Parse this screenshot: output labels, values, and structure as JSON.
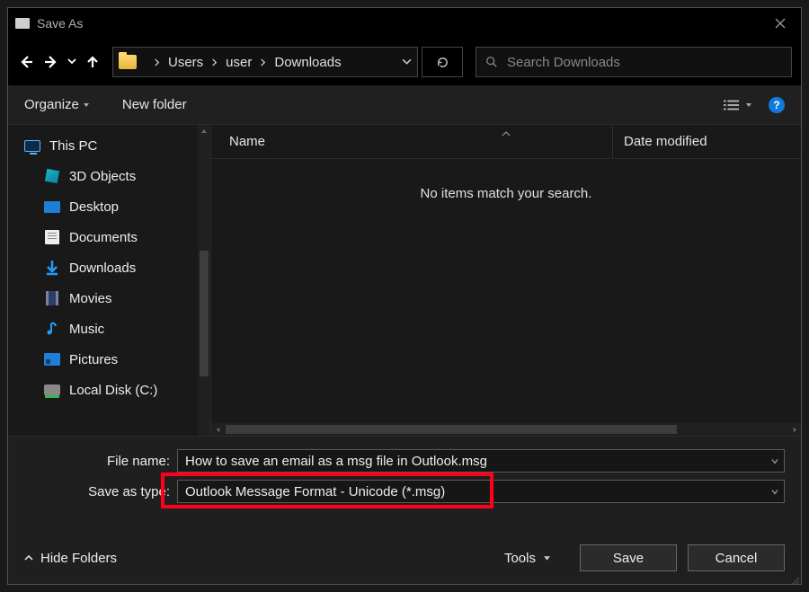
{
  "titlebar": {
    "title": "Save As"
  },
  "nav": {
    "breadcrumb": [
      "Users",
      "user",
      "Downloads"
    ],
    "search_placeholder": "Search Downloads"
  },
  "toolbar": {
    "organize": "Organize",
    "new_folder": "New folder",
    "help": "?"
  },
  "sidebar": {
    "items": [
      {
        "label": "This PC",
        "icon": "monitor",
        "child": false
      },
      {
        "label": "3D Objects",
        "icon": "3d",
        "child": true
      },
      {
        "label": "Desktop",
        "icon": "desktop",
        "child": true
      },
      {
        "label": "Documents",
        "icon": "doc",
        "child": true
      },
      {
        "label": "Downloads",
        "icon": "download",
        "child": true
      },
      {
        "label": "Movies",
        "icon": "movie",
        "child": true
      },
      {
        "label": "Music",
        "icon": "music",
        "child": true
      },
      {
        "label": "Pictures",
        "icon": "picture",
        "child": true
      },
      {
        "label": "Local Disk (C:)",
        "icon": "disk",
        "child": true
      }
    ]
  },
  "content": {
    "columns": {
      "name": "Name",
      "date_modified": "Date modified"
    },
    "empty_message": "No items match your search."
  },
  "fields": {
    "file_name_label": "File name:",
    "file_name_value": "How to save an email as a msg file in Outlook.msg",
    "save_as_type_label": "Save as type:",
    "save_as_type_value": "Outlook Message Format - Unicode (*.msg)"
  },
  "actions": {
    "hide_folders": "Hide Folders",
    "tools": "Tools",
    "save": "Save",
    "cancel": "Cancel"
  }
}
